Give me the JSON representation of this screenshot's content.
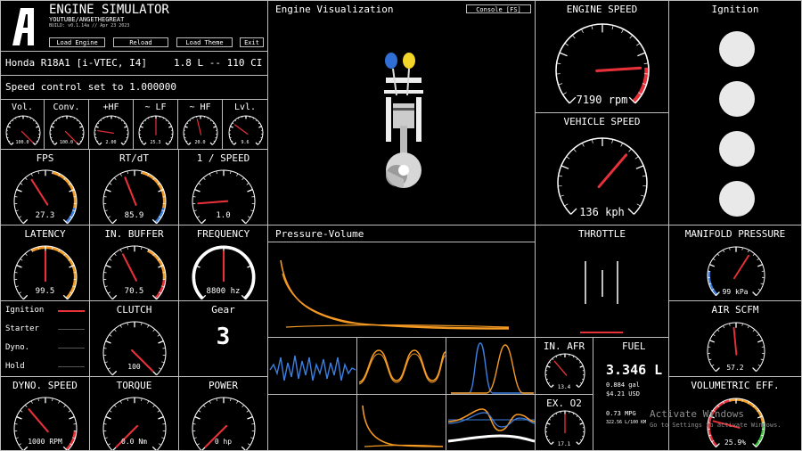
{
  "header": {
    "title": "ENGINE SIMULATOR",
    "channel": "YOUTUBE/ANGETHEGREAT",
    "build": "BUILD: v0.1.14a // Apr 23 2023",
    "buttons": [
      "Load Engine",
      "Reload",
      "Load Theme",
      "Exit"
    ]
  },
  "engine": {
    "name": "Honda R18A1 [i-VTEC, I4]",
    "displacement": "1.8 L -- 110 CI",
    "speed_control": "Speed control set to 1.000000"
  },
  "mixer": {
    "gauges": [
      {
        "label": "Vol.",
        "value": "100.0",
        "fraction": 1.0
      },
      {
        "label": "Conv.",
        "value": "100.0",
        "fraction": 1.0
      },
      {
        "label": "+HF",
        "value": "2.00",
        "fraction": 0.2
      },
      {
        "label": "~ LF",
        "value": "25.3",
        "fraction": 0.5
      },
      {
        "label": "~ HF",
        "value": "20.0",
        "fraction": 0.45
      },
      {
        "label": "Lvl.",
        "value": "9.6",
        "fraction": 0.3
      }
    ]
  },
  "perf": {
    "fps": {
      "label": "FPS",
      "value": "27.3"
    },
    "rtdt": {
      "label": "RT/dT",
      "value": "85.9"
    },
    "one_over_speed": {
      "label": "1 / SPEED",
      "value": "1.0"
    },
    "latency": {
      "label": "LATENCY",
      "value": "99.5"
    },
    "in_buffer": {
      "label": "IN. BUFFER",
      "value": "70.5"
    },
    "frequency": {
      "label": "FREQUENCY",
      "value": "8800 hz"
    }
  },
  "controls": {
    "labels": [
      "Ignition",
      "Starter",
      "Dyno.",
      "Hold"
    ],
    "clutch": {
      "label": "CLUTCH",
      "value": "100"
    },
    "gear": {
      "label": "Gear",
      "value": "3"
    }
  },
  "dyno": {
    "speed": {
      "label": "DYNO. SPEED",
      "value": "1000 RPM"
    },
    "torque": {
      "label": "TORQUE",
      "value": "0.0 Nm"
    },
    "power": {
      "label": "POWER",
      "value": "0 hp"
    }
  },
  "viz": {
    "title": "Engine Visualization",
    "console_button": "Console [FS]"
  },
  "pv": {
    "title": "Pressure-Volume"
  },
  "speedo": {
    "engine": {
      "label": "ENGINE SPEED",
      "value": "7190 rpm"
    },
    "vehicle": {
      "label": "VEHICLE SPEED",
      "value": "136 kph"
    }
  },
  "throttle": {
    "label": "THROTTLE"
  },
  "afr": {
    "label": "IN. AFR",
    "value": "13.4"
  },
  "o2": {
    "label": "EX. O2",
    "value": "17.1"
  },
  "fuel": {
    "label": "FUEL",
    "value": "3.346 L",
    "gallons": "0.884 gal",
    "cost": "$4.21 USD",
    "mpg": "0.73 MPG",
    "consumption": "322.56 L/100 KM"
  },
  "ignition_panel": {
    "title": "Ignition"
  },
  "manifold": {
    "label": "MANIFOLD PRESSURE",
    "value": "99 kPa"
  },
  "air": {
    "label": "AIR SCFM",
    "value": "57.2"
  },
  "vol_eff": {
    "label": "VOLUMETRIC EFF.",
    "value": "25.9%"
  },
  "watermark": {
    "line1": "Activate Windows",
    "line2": "Go to Settings to activate Windows."
  },
  "colors": {
    "orange": "#f59a23",
    "blue": "#3d7fe0",
    "red": "#e8303a",
    "green": "#3bbf3b",
    "border": "#bdbdbd"
  }
}
